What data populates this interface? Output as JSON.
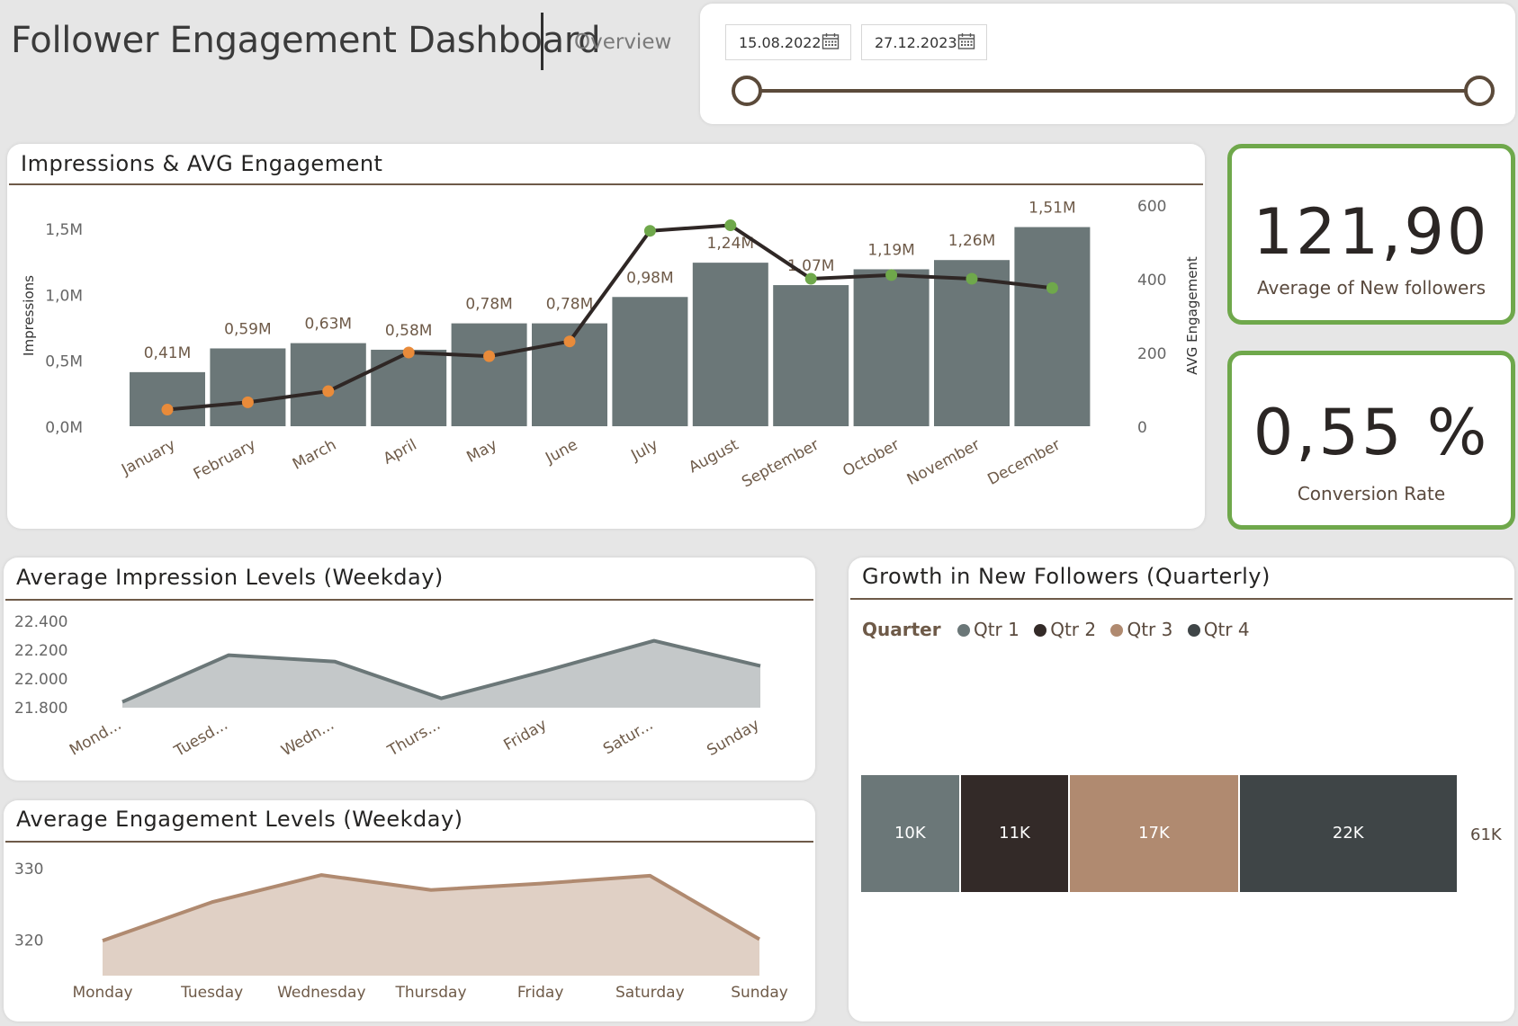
{
  "header": {
    "title": "Follower Engagement Dashboard",
    "nav": "Overview",
    "date_start": "15.08.2022",
    "date_end": "27.12.2023",
    "slider_position": {
      "start": 0.0,
      "end": 1.0
    }
  },
  "kpis": {
    "new_followers_value": "121,90",
    "new_followers_label": "Average of New followers",
    "conversion_value": "0,55 %",
    "conversion_label": "Conversion Rate"
  },
  "colors": {
    "bar": "#6b7778",
    "line": "#2f2725",
    "below_marker": "#e98b3a",
    "above_marker": "#6fa84b",
    "accent_border": "#6fa84b",
    "impression_area": "#c4c8c9",
    "impression_line": "#6b7778",
    "engagement_area": "#e0d0c5",
    "engagement_line": "#b08a70",
    "q1": "#6b7778",
    "q2": "#332a28",
    "q3": "#b08a70",
    "q4": "#3f4547"
  },
  "icons": {
    "calendar": "calendar-icon"
  },
  "chart_data": [
    {
      "type": "bar",
      "title": "Impressions & AVG Engagement",
      "ylabel": "Impressions",
      "y2label": "AVG Engagement",
      "categories": [
        "January",
        "February",
        "March",
        "April",
        "May",
        "June",
        "July",
        "August",
        "September",
        "October",
        "November",
        "December"
      ],
      "series": [
        {
          "name": "Impressions",
          "type": "bar",
          "axis": "left",
          "values": [
            0.41,
            0.59,
            0.63,
            0.58,
            0.78,
            0.78,
            0.98,
            1.24,
            1.07,
            1.19,
            1.26,
            1.51
          ],
          "labels": [
            "0,41M",
            "0,59M",
            "0,63M",
            "0,58M",
            "0,78M",
            "0,78M",
            "0,98M",
            "1,24M",
            "1,07M",
            "1,19M",
            "1,26M",
            "1,51M"
          ]
        },
        {
          "name": "AVG Engagement",
          "type": "line",
          "axis": "right",
          "values": [
            45,
            65,
            95,
            200,
            190,
            230,
            530,
            545,
            400,
            410,
            400,
            375
          ]
        }
      ],
      "ylim": [
        0,
        1.8
      ],
      "yticks": [
        "0,0M",
        "0,5M",
        "1,0M",
        "1,5M"
      ],
      "ytick_values": [
        0,
        0.5,
        1.0,
        1.5
      ],
      "y2lim": [
        0,
        600
      ],
      "y2ticks": [
        "0",
        "200",
        "400",
        "600"
      ],
      "y2tick_values": [
        0,
        200,
        400,
        600
      ],
      "grid": false
    },
    {
      "type": "area",
      "title": "Average Impression Levels (Weekday)",
      "categories": [
        "Mond...",
        "Tuesd...",
        "Wedn...",
        "Thurs...",
        "Friday",
        "Satur...",
        "Sunday"
      ],
      "values": [
        21840,
        22165,
        22120,
        21865,
        22060,
        22265,
        22090
      ],
      "ylim": [
        21800,
        22400
      ],
      "yticks": [
        "21.800",
        "22.000",
        "22.200",
        "22.400"
      ],
      "ytick_values": [
        21800,
        22000,
        22200,
        22400
      ]
    },
    {
      "type": "area",
      "title": "Average Engagement Levels (Weekday)",
      "categories": [
        "Monday",
        "Tuesday",
        "Wednesday",
        "Thursday",
        "Friday",
        "Saturday",
        "Sunday"
      ],
      "values": [
        319.9,
        325.3,
        329.1,
        327.0,
        327.9,
        329.0,
        320.1
      ],
      "ylim": [
        315,
        331
      ],
      "yticks": [
        "320",
        "330"
      ],
      "ytick_values": [
        320,
        330
      ]
    },
    {
      "type": "bar",
      "title": "Growth in New Followers (Quarterly)",
      "legend_title": "Quarter",
      "series": [
        {
          "name": "Qtr 1",
          "value": 10,
          "label": "10K"
        },
        {
          "name": "Qtr 2",
          "value": 11,
          "label": "11K"
        },
        {
          "name": "Qtr 3",
          "value": 17,
          "label": "17K"
        },
        {
          "name": "Qtr 4",
          "value": 22,
          "label": "22K"
        }
      ],
      "total_label": "61K",
      "stacked": true,
      "orientation": "horizontal",
      "legend_position": "top-left"
    }
  ]
}
